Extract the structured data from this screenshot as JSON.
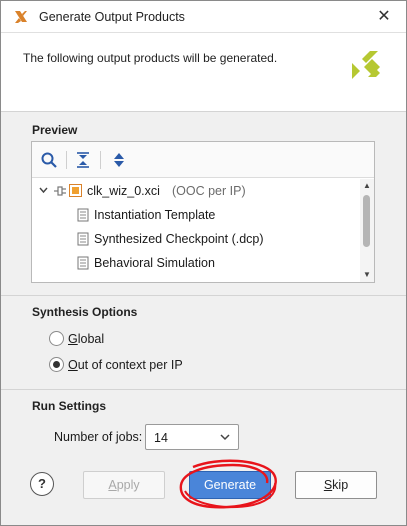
{
  "window": {
    "title": "Generate Output Products",
    "close_icon": "close-icon"
  },
  "header": {
    "message": "The following output products will be generated."
  },
  "preview": {
    "title": "Preview",
    "toolbar": [
      "search-icon",
      "collapse-all-icon",
      "expand-all-icon"
    ],
    "tree": [
      {
        "label": "clk_wiz_0.xci",
        "note": "(OOC per IP)",
        "level": 0,
        "expanded": true,
        "icon": "ip-core-icon"
      },
      {
        "label": "Instantiation Template",
        "level": 1,
        "icon": "file-icon"
      },
      {
        "label": "Synthesized Checkpoint (.dcp)",
        "level": 1,
        "icon": "file-icon"
      },
      {
        "label": "Behavioral Simulation",
        "level": 1,
        "icon": "file-icon"
      }
    ]
  },
  "synthesis": {
    "title": "Synthesis Options",
    "options": [
      {
        "label": "Global",
        "mnemonic": "G",
        "rest": "lobal",
        "checked": false
      },
      {
        "label": "Out of context per IP",
        "mnemonic": "O",
        "rest": "ut of context per IP",
        "checked": true
      }
    ]
  },
  "run": {
    "title": "Run Settings",
    "jobs_label_pre": "Number of ",
    "jobs_label_mnem": "j",
    "jobs_label_post": "obs:",
    "jobs_value": "14"
  },
  "buttons": {
    "help": "?",
    "apply_mnem": "A",
    "apply_rest": "pply",
    "generate": "Generate",
    "skip_mnem": "S",
    "skip_rest": "kip"
  },
  "colors": {
    "primary": "#4a85d9",
    "annotation": "#e8141b",
    "brand": "#b6c832"
  }
}
